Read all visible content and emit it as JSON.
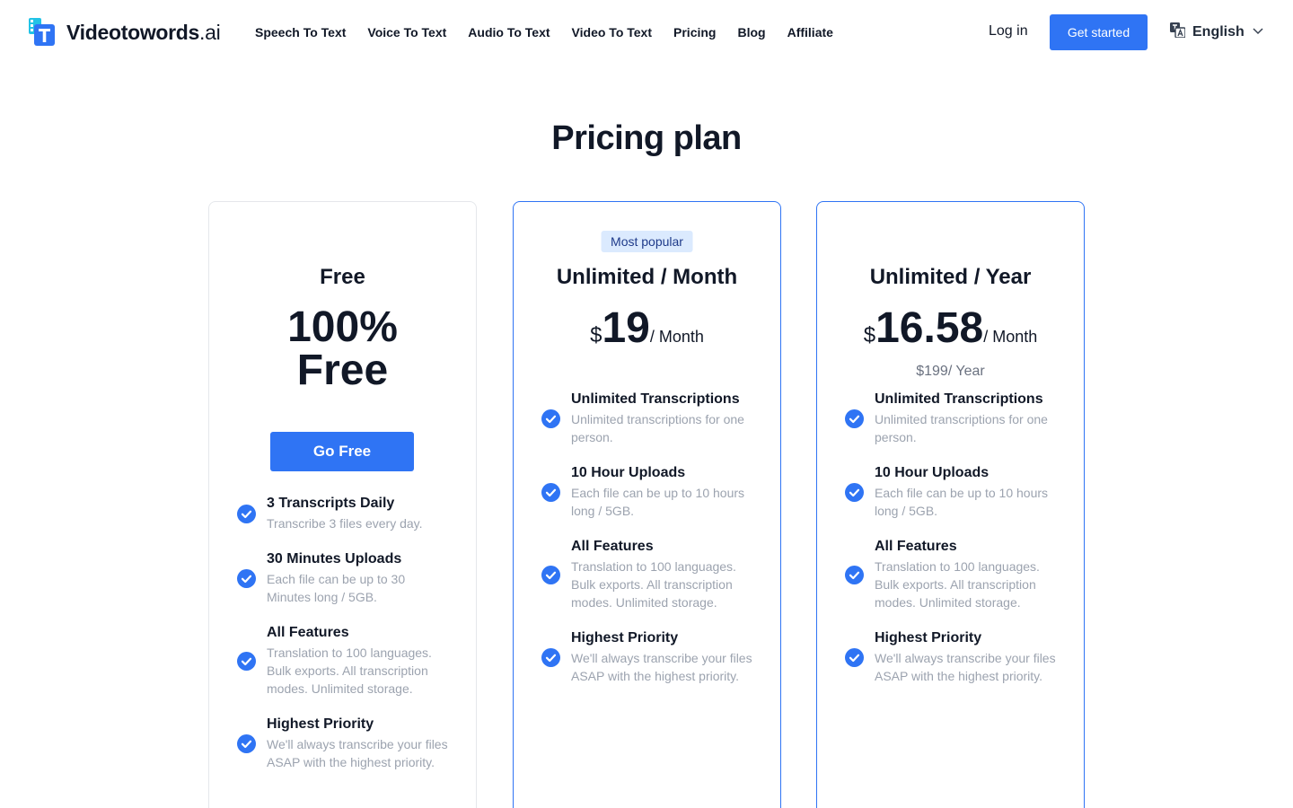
{
  "header": {
    "logo": {
      "brand": "Videotowords",
      "suffix": ".ai"
    },
    "nav": [
      "Speech To Text",
      "Voice To Text",
      "Audio To Text",
      "Video To Text",
      "Pricing",
      "Blog",
      "Affiliate"
    ],
    "login_label": "Log in",
    "get_started_label": "Get started",
    "language": {
      "label": "English",
      "icon": "translate-icon"
    }
  },
  "page": {
    "title": "Pricing plan"
  },
  "colors": {
    "accent": "#2f74f4",
    "badge_bg": "#dbeafe",
    "muted_text": "#9ca3af"
  },
  "plans": [
    {
      "name": "Free",
      "price_line1": "100%",
      "price_line2": "Free",
      "cta_label": "Go Free",
      "features": [
        {
          "title": "3 Transcripts Daily",
          "desc": "Transcribe 3 files every day."
        },
        {
          "title": "30 Minutes Uploads",
          "desc": "Each file can be up to 30 Minutes long / 5GB."
        },
        {
          "title": "All Features",
          "desc": "Translation to 100 languages. Bulk exports. All transcription modes. Unlimited storage."
        },
        {
          "title": "Highest Priority",
          "desc": "We'll always transcribe your files ASAP with the highest priority."
        }
      ]
    },
    {
      "badge": "Most popular",
      "name": "Unlimited / Month",
      "currency": "$",
      "amount": "19",
      "period": "/ Month",
      "features": [
        {
          "title": "Unlimited Transcriptions",
          "desc": "Unlimited transcriptions for one person."
        },
        {
          "title": "10 Hour Uploads",
          "desc": "Each file can be up to 10 hours long / 5GB."
        },
        {
          "title": "All Features",
          "desc": "Translation to 100 languages. Bulk exports. All transcription modes. Unlimited storage."
        },
        {
          "title": "Highest Priority",
          "desc": "We'll always transcribe your files ASAP with the highest priority."
        }
      ]
    },
    {
      "name": "Unlimited / Year",
      "currency": "$",
      "amount": "16.58",
      "period": "/ Month",
      "sub_price": "$199/ Year",
      "features": [
        {
          "title": "Unlimited Transcriptions",
          "desc": "Unlimited transcriptions for one person."
        },
        {
          "title": "10 Hour Uploads",
          "desc": "Each file can be up to 10 hours long / 5GB."
        },
        {
          "title": "All Features",
          "desc": "Translation to 100 languages. Bulk exports. All transcription modes. Unlimited storage."
        },
        {
          "title": "Highest Priority",
          "desc": "We'll always transcribe your files ASAP with the highest priority."
        }
      ]
    }
  ]
}
